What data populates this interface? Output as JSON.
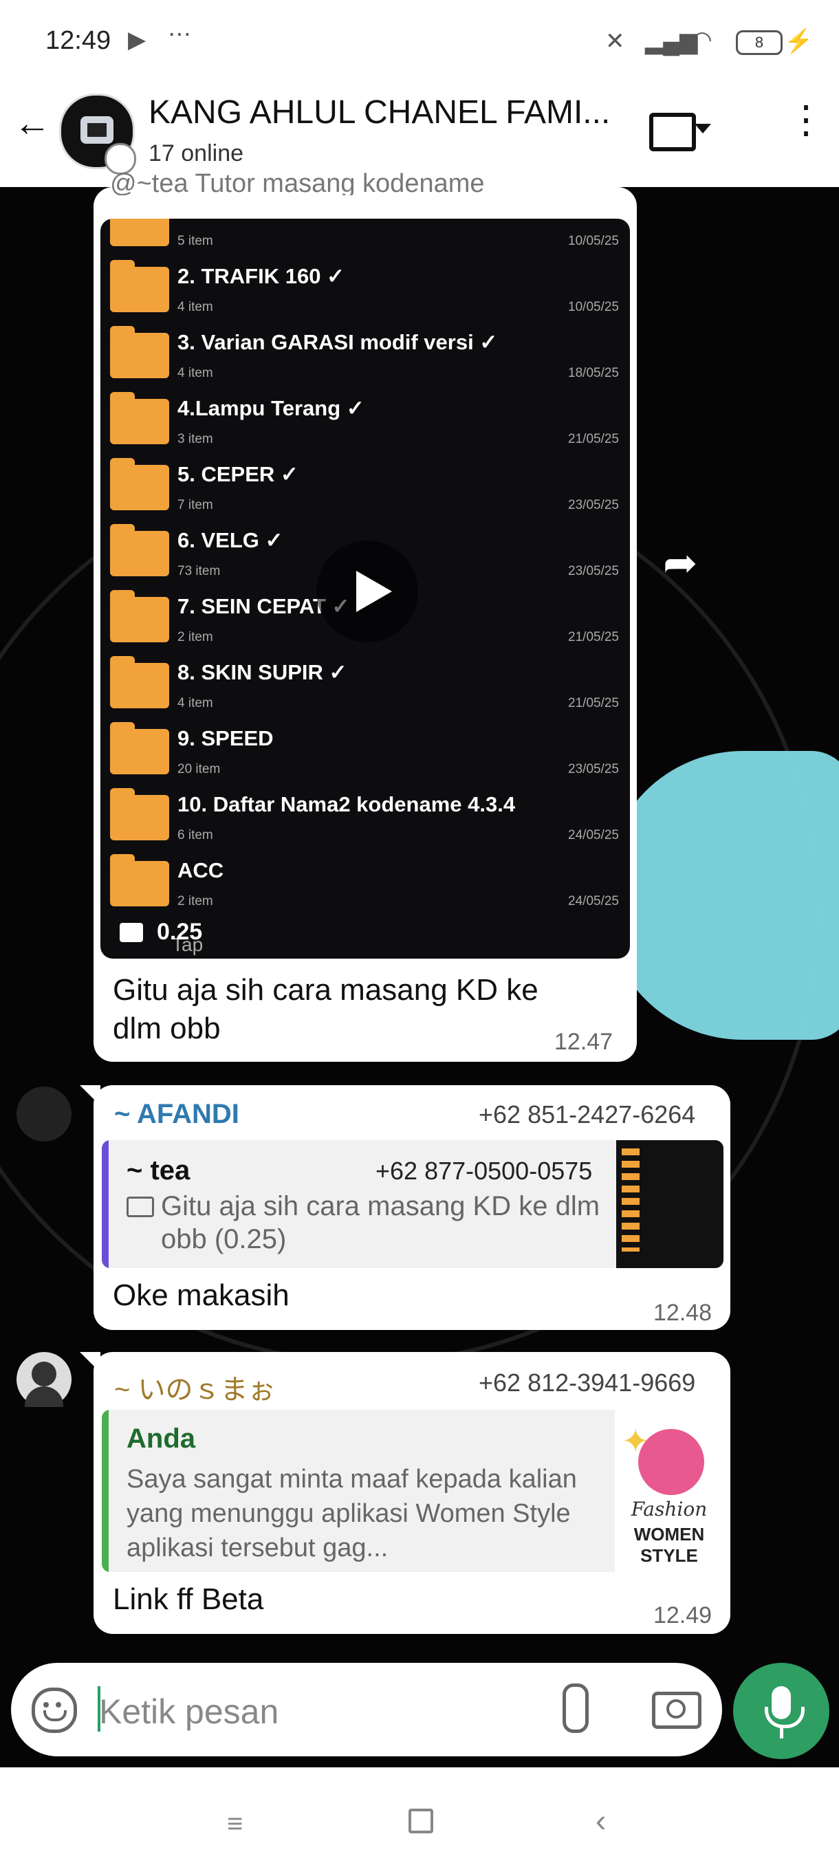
{
  "status_bar": {
    "time": "12:49",
    "extra": "⋯",
    "battery": "8"
  },
  "header": {
    "title": "KANG AHLUL CHANEL FAMI...",
    "subtitle": "17 online"
  },
  "video_message": {
    "top_caption": "@~tea Tutor masang kodename",
    "folders": [
      {
        "name": "",
        "count": "5 item",
        "date": "10/05/25"
      },
      {
        "name": "2. TRAFIK 160 ✓",
        "count": "4 item",
        "date": "10/05/25"
      },
      {
        "name": "3. Varian GARASI modif versi ✓",
        "count": "4 item",
        "date": "18/05/25"
      },
      {
        "name": "4.Lampu Terang ✓",
        "count": "3 item",
        "date": "21/05/25"
      },
      {
        "name": "5. CEPER ✓",
        "count": "7 item",
        "date": "23/05/25"
      },
      {
        "name": "6. VELG ✓",
        "count": "73 item",
        "date": "23/05/25"
      },
      {
        "name": "7. SEIN CEPAT ✓",
        "count": "2 item",
        "date": "21/05/25"
      },
      {
        "name": "8. SKIN SUPIR ✓",
        "count": "4 item",
        "date": "21/05/25"
      },
      {
        "name": "9. SPEED",
        "count": "20 item",
        "date": "23/05/25"
      },
      {
        "name": "10. Daftar Nama2 kodename 4.3.4",
        "count": "6 item",
        "date": "24/05/25"
      },
      {
        "name": "ACC",
        "count": "2 item",
        "date": "24/05/25"
      }
    ],
    "duration": "0.25",
    "partial_label": "Tap",
    "caption": "Gitu aja sih cara masang KD ke dlm obb",
    "time": "12.47"
  },
  "message_afandi": {
    "sender": "~ AFANDI",
    "phone": "+62 851-2427-6264",
    "quote_sender": "~ tea",
    "quote_phone": "+62 877-0500-0575",
    "quote_text": "Gitu aja sih cara masang KD ke dlm obb (0.25)",
    "text": "Oke makasih",
    "time": "12.48",
    "sender_color": "#2f7ab0"
  },
  "message_inosama": {
    "sender": "~ いのｓまぉ",
    "phone": "+62 812-3941-9669",
    "quote_sender": "Anda",
    "quote_text": "Saya sangat minta maaf kepada kalian yang menunggu aplikasi Women Style aplikasi tersebut gag...",
    "thumb_line1": "Fashion",
    "thumb_line2": "WOMEN STYLE",
    "text": "Link ff Beta",
    "time": "12.49",
    "sender_color": "#a07a2a"
  },
  "composer": {
    "placeholder": "Ketik pesan"
  },
  "icons": [
    "back-arrow-icon",
    "video-call-icon",
    "more-vert-icon",
    "emoji-icon",
    "attach-icon",
    "camera-icon",
    "mic-icon",
    "play-icon",
    "forward-icon"
  ],
  "colors": {
    "accent": "#2e9e63",
    "afandi_bar": "#6b4fd8",
    "anda_bar": "#4caf50"
  }
}
